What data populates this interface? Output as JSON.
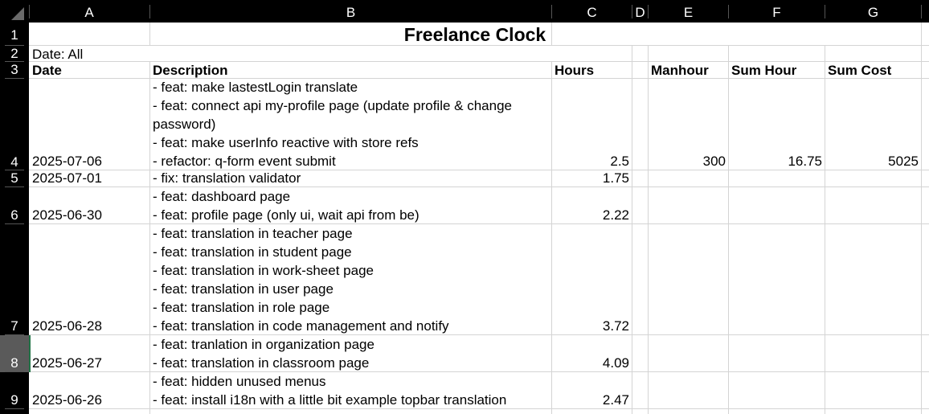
{
  "columns": [
    "A",
    "B",
    "C",
    "D",
    "E",
    "F",
    "G"
  ],
  "rows": [
    "1",
    "2",
    "3",
    "4",
    "5",
    "6",
    "7",
    "8",
    "9"
  ],
  "title": "Freelance Clock",
  "date_filter": "Date: All",
  "headers": {
    "date": "Date",
    "description": "Description",
    "hours": "Hours",
    "manhour": "Manhour",
    "sum_hour": "Sum Hour",
    "sum_cost": "Sum Cost"
  },
  "summary": {
    "manhour": "300",
    "sum_hour": "16.75",
    "sum_cost": "5025"
  },
  "entries": [
    {
      "date": "2025-07-06",
      "hours": "2.5",
      "lines": [
        "- feat: make lastestLogin translate",
        "- feat: connect api my-profile page (update profile & change",
        "password)",
        "- feat: make userInfo reactive with store refs",
        "- refactor: q-form event submit"
      ]
    },
    {
      "date": "2025-07-01",
      "hours": "1.75",
      "lines": [
        "- fix: translation validator"
      ]
    },
    {
      "date": "2025-06-30",
      "hours": "2.22",
      "lines": [
        "- feat: dashboard page",
        "- feat: profile page (only ui, wait api from be)"
      ]
    },
    {
      "date": "2025-06-28",
      "hours": "3.72",
      "lines": [
        "- feat: translation in teacher page",
        "- feat: translation in student page",
        "- feat: translation in work-sheet page",
        "- feat: translation in user page",
        "- feat: translation in role page",
        "- feat: translation in code management and notify"
      ]
    },
    {
      "date": "2025-06-27",
      "hours": "4.09",
      "lines": [
        "- feat: tranlation in organization page",
        "- feat: translation in classroom page"
      ]
    },
    {
      "date": "2025-06-26",
      "hours": "2.47",
      "lines": [
        "- feat: hidden unused menus",
        "- feat: install i18n with a little bit example topbar translation"
      ]
    }
  ]
}
